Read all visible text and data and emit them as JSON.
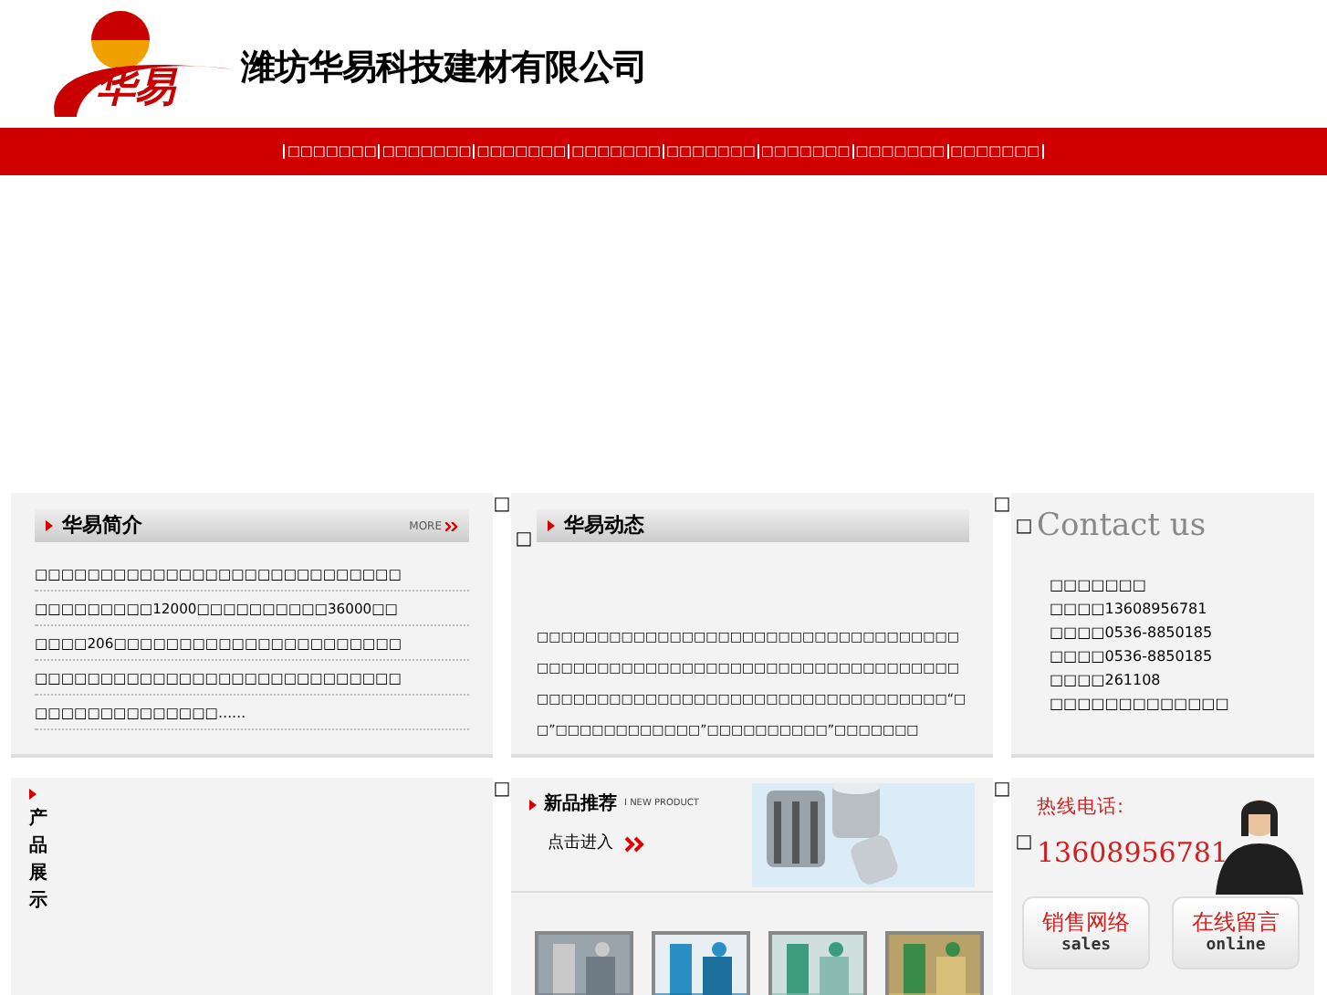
{
  "header": {
    "logo_text": "华易",
    "company_name": "潍坊华易科技建材有限公司"
  },
  "nav": {
    "items": [
      "□□□□□□□",
      "□□□□□□□",
      "□□□□□□□",
      "□□□□□□□",
      "□□□□□□□",
      "□□□□□□□",
      "□□□□□□□",
      "□□□□□□□"
    ]
  },
  "intro": {
    "title": "华易简介",
    "more": "MORE",
    "after_mark": "□",
    "lines": [
      "□□□□□□□□□□□□□□□□□□□□□□□□□□□□",
      "□□□□□□□□□12000□□□□□□□□□□36000□□",
      "□□□□206□□□□□□□□□□□□□□□□□□□□□□",
      "□□□□□□□□□□□□□□□□□□□□□□□□□□□□",
      "□□□□□□□□□□□□□□……"
    ]
  },
  "news": {
    "title": "华易动态",
    "before_mark": "□",
    "after_mark": "□",
    "text": "□□□□□□□□□□□□□□□□□□□□□□□□□□□□□□□□□□□□□□□□□□□□□□□□□□□□□□□□□□□□□□□□□□□□□□□□□□□□□□□□□□□□□□□□□□□□□□□□□□□□□□□□“□□”□□□□□□□□□□□□”□□□□□□□□□□”□□□□□□□"
  },
  "contact": {
    "title": "Contact us",
    "before_mark": "□",
    "lines": [
      "□□□□□□□",
      "□□□□13608956781",
      "□□□□0536-8850185",
      "□□□□0536-8850185",
      "□□□□261108",
      "□□□□□□□□□□□□□"
    ]
  },
  "products": {
    "title": [
      "产",
      "品",
      "展",
      "示"
    ],
    "after_mark": "□"
  },
  "new_product": {
    "title": "新品推荐",
    "subtitle": "I NEW PRODUCT",
    "enter": "点击进入",
    "after_mark": "□"
  },
  "hotline": {
    "label": "热线电话:",
    "before_mark": "□",
    "phone": "13608956781",
    "buttons": [
      {
        "label": "销售网络",
        "sub": "sales"
      },
      {
        "label": "在线留言",
        "sub": "online"
      }
    ]
  }
}
